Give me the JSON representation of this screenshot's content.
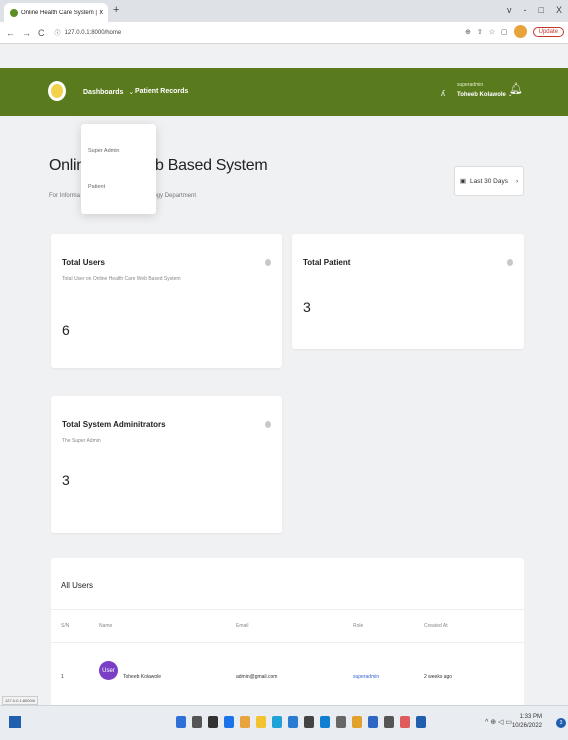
{
  "browser": {
    "tab_title": "Online Health Care System | Ou",
    "tab_close": "x",
    "new_tab": "+",
    "controls": [
      "v",
      "-",
      "□",
      "X"
    ],
    "nav": [
      "←",
      "→",
      "C"
    ],
    "url": "127.0.0.1:8000/home",
    "addr_icons": [
      "⊕",
      "⇧",
      "☆",
      "▢"
    ],
    "update_label": "Update"
  },
  "navbar": {
    "color": "#5a7a1e",
    "menu_dashboards": "Dashboards",
    "menu_patient_records": "Patient Records",
    "user_role": "superadmin",
    "user_name": "Toheeb Kolawole"
  },
  "dropdown": {
    "items": [
      "Super Admin",
      "Patient"
    ]
  },
  "page": {
    "title_left": "Online",
    "title_right": "eb Based System",
    "subtitle_left": "For Informa",
    "subtitle_right": "logy Department",
    "range_label": "Last 30 Days"
  },
  "cards": {
    "total_users": {
      "title": "Total Users",
      "subtitle": "Total User on Online Health Care Web Based System",
      "value": "6"
    },
    "total_patient": {
      "title": "Total Patient",
      "value": "3"
    },
    "total_admins": {
      "title": "Total System Adminitrators",
      "subtitle": "The Super Admin",
      "value": "3"
    }
  },
  "table": {
    "title": "All Users",
    "headers": [
      "S/N",
      "Name",
      "Email",
      "Role",
      "Created At"
    ],
    "rows": [
      {
        "sn": "1",
        "avatar": "User",
        "name": "Toheeb Kolawole",
        "email": "admin@gmail.com",
        "role": "superadmin",
        "created": "2 weeks ago"
      }
    ]
  },
  "status_url": "127.0.0.1:8000/#",
  "taskbar": {
    "time": "1:33 PM",
    "date": "10/26/2022",
    "tray": "^ ⊕ ◁ ▭",
    "notifications": "3"
  }
}
